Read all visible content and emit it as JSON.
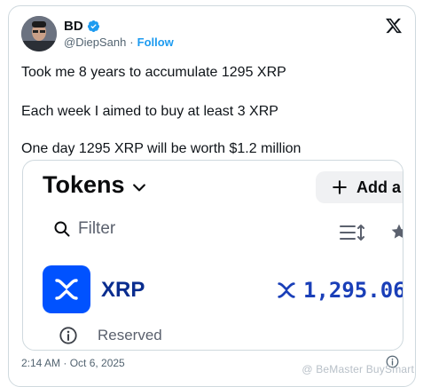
{
  "tweet": {
    "author_name": "BD",
    "handle": "@DiepSanh",
    "separator": "·",
    "follow_label": "Follow",
    "lines": [
      "Took me 8 years to accumulate 1295 XRP",
      "Each week I aimed to buy at least 3 XRP",
      "One day 1295 XRP will be worth $1.2 million"
    ],
    "timestamp": "2:14 AM · Oct 6, 2025"
  },
  "media": {
    "title": "Tokens",
    "add_label": "Add a",
    "filter_placeholder": "Filter",
    "asset": {
      "name": "XRP",
      "amount": "1,295.06",
      "status": "Reserved"
    }
  },
  "watermark": "@ BeMaster BuySmart",
  "colors": {
    "brand_blue": "#0052ff",
    "follow_blue": "#1d9bf0",
    "verified_blue": "#1d9bf0"
  },
  "icons": [
    "verified-badge-icon",
    "x-logo-icon",
    "chevron-down-icon",
    "plus-icon",
    "search-icon",
    "sort-icon",
    "star-icon",
    "xrp-logo-icon",
    "info-icon"
  ]
}
